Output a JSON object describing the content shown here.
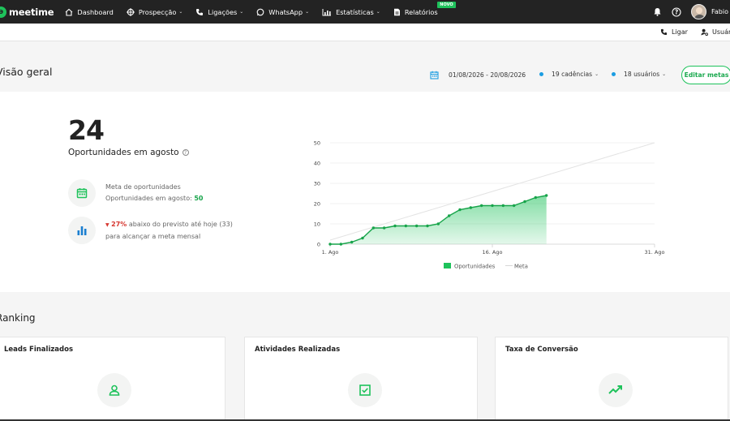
{
  "nav": {
    "logo": "meetime",
    "items": [
      {
        "label": "Dashboard",
        "icon": "home-icon",
        "chevron": false
      },
      {
        "label": "Prospecção",
        "icon": "target-icon",
        "chevron": true
      },
      {
        "label": "Ligações",
        "icon": "phone-icon",
        "chevron": true
      },
      {
        "label": "WhatsApp",
        "icon": "whatsapp-icon",
        "chevron": true
      },
      {
        "label": "Estatísticas",
        "icon": "stats-icon",
        "chevron": true
      },
      {
        "label": "Relatórios",
        "icon": "report-icon",
        "chevron": false,
        "badge": "NOVO"
      }
    ],
    "user_name": "Fabio"
  },
  "subbar": {
    "call_label": "Ligar",
    "users_label": "Usuári"
  },
  "overview": {
    "title": "Visão geral",
    "date_range": "01/08/2026 - 20/08/2026",
    "cadences": "19 cadências",
    "users": "18 usuários",
    "edit_button": "Editar metas",
    "total": "24",
    "total_label": "Oportunidades em agosto",
    "goal_title": "Meta de oportunidades",
    "goal_line_prefix": "Oportunidades em agosto: ",
    "goal_value": "50",
    "below_percent": "27%",
    "below_text": " abaixo do previsto até hoje (33)",
    "below_line2": "para alcançar a meta mensal"
  },
  "chart_data": {
    "type": "area",
    "x_tick_labels": [
      "1. Ago",
      "16. Ago",
      "31. Ago"
    ],
    "x_range": [
      1,
      31
    ],
    "ylim": [
      0,
      50
    ],
    "y_ticks": [
      0,
      10,
      20,
      30,
      40,
      50
    ],
    "grid": true,
    "legend_position": "bottom",
    "series": [
      {
        "name": "Oportunidades",
        "type": "area",
        "color": "#1ec25b",
        "x": [
          1,
          2,
          3,
          4,
          5,
          6,
          7,
          8,
          9,
          10,
          11,
          12,
          13,
          14,
          15,
          16,
          17,
          18,
          19,
          20,
          21
        ],
        "values": [
          0,
          0,
          1,
          3,
          8,
          8,
          9,
          9,
          9,
          9,
          10,
          14,
          17,
          18,
          19,
          19,
          19,
          19,
          21,
          23,
          24
        ]
      },
      {
        "name": "Meta",
        "type": "line",
        "color": "#e3e3e3",
        "x": [
          1,
          31
        ],
        "values": [
          2,
          50
        ]
      }
    ]
  },
  "ranking": {
    "title": "Ranking",
    "cards": [
      {
        "title": "Leads Finalizados",
        "icon": "user-icon"
      },
      {
        "title": "Atividades Realizadas",
        "icon": "checkbox-icon"
      },
      {
        "title": "Taxa de Conversão",
        "icon": "trending-up-icon"
      }
    ]
  },
  "colors": {
    "accent": "#1ec25b",
    "nav_bg": "#232323",
    "negative": "#d6362f",
    "info": "#1b9de2"
  }
}
